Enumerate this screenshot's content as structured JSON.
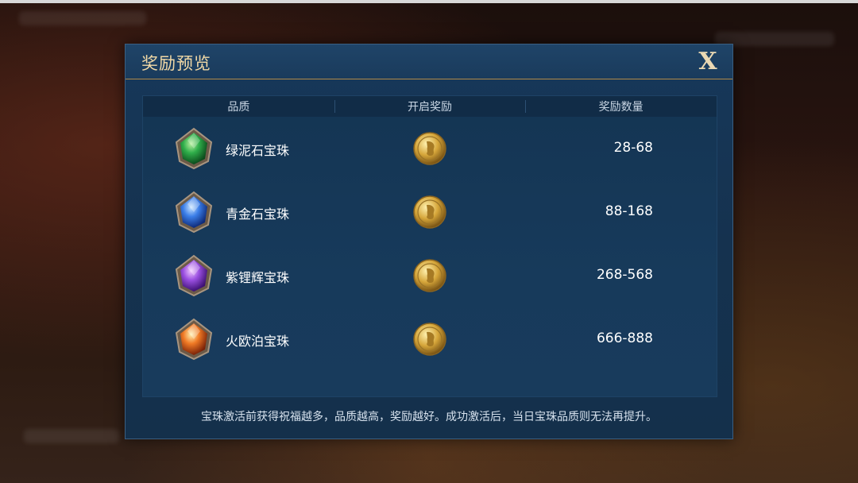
{
  "dialog": {
    "title": "奖励预览",
    "close_label": "X"
  },
  "table": {
    "headers": [
      "品质",
      "开启奖励",
      "奖励数量"
    ],
    "rows": [
      {
        "name": "绿泥石宝珠",
        "amount": "28-68",
        "gem_color": "#2fae4a",
        "gem_icon": "green-gem-icon",
        "reward_icon": "gold-coin-icon"
      },
      {
        "name": "青金石宝珠",
        "amount": "88-168",
        "gem_color": "#3b7ee8",
        "gem_icon": "blue-gem-icon",
        "reward_icon": "gold-coin-icon"
      },
      {
        "name": "紫锂辉宝珠",
        "amount": "268-568",
        "gem_color": "#9a4fe0",
        "gem_icon": "purple-gem-icon",
        "reward_icon": "gold-coin-icon"
      },
      {
        "name": "火欧泊宝珠",
        "amount": "666-888",
        "gem_color": "#f07a25",
        "gem_icon": "orange-gem-icon",
        "reward_icon": "gold-coin-icon"
      }
    ]
  },
  "footer": {
    "note": "宝珠激活前获得祝福越多，品质越高，奖励越好。成功激活后，当日宝珠品质则无法再提升。"
  },
  "colors": {
    "title_gold": "#f2d9a6",
    "panel_blue": "#15324f",
    "divider_gold": "#b08a4a"
  }
}
